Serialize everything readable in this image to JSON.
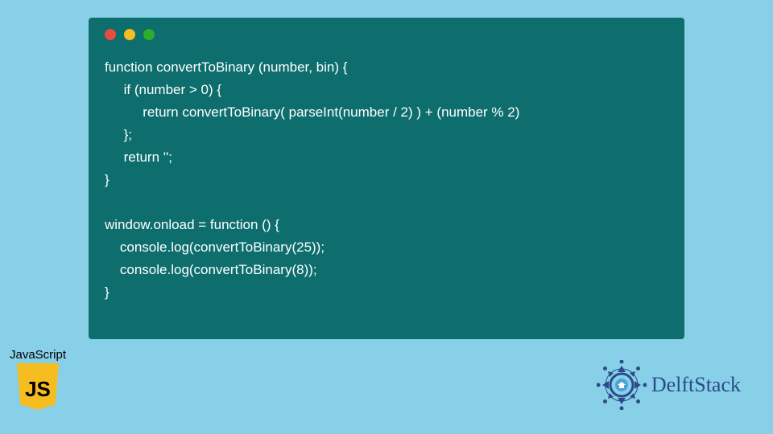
{
  "code": {
    "lines": [
      "function convertToBinary (number, bin) {",
      "     if (number > 0) {",
      "          return convertToBinary( parseInt(number / 2) ) + (number % 2)",
      "     };",
      "     return '';",
      "}",
      "",
      "window.onload = function () {",
      "    console.log(convertToBinary(25));",
      "    console.log(convertToBinary(8));",
      "}"
    ]
  },
  "jsBadge": {
    "label": "JavaScript",
    "logoText": "JS"
  },
  "delft": {
    "label": "DelftStack"
  },
  "colors": {
    "bg": "#88d0e8",
    "codeBg": "#0e6e6e",
    "red": "#e94b3c",
    "yellow": "#f5bd1f",
    "green": "#2bae2b",
    "delftBlue": "#2b4a8b"
  }
}
